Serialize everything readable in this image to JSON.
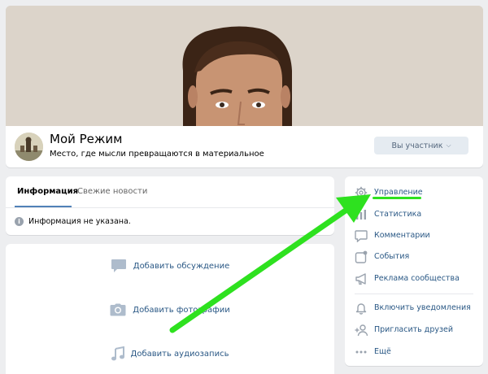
{
  "community": {
    "name": "Мой Режим",
    "status": "Место, где мысли превращаются в материальное",
    "member_button": "Вы участник",
    "member_chevron": "⌵"
  },
  "info_tabs": {
    "tabs": [
      {
        "label": "Информация",
        "active": true
      },
      {
        "label": "Свежие новости",
        "active": false
      }
    ],
    "info_icon": "i",
    "info_text": "Информация не указана."
  },
  "actions": [
    {
      "label": "Добавить обсуждение",
      "icon": "discussion-icon"
    },
    {
      "label": "Добавить фотографии",
      "icon": "camera-icon"
    },
    {
      "label": "Добавить аудиозапись",
      "icon": "music-note-icon"
    }
  ],
  "side_menu": {
    "items": [
      {
        "label": "Управление",
        "icon": "gear-icon"
      },
      {
        "label": "Статистика",
        "icon": "statistics-icon"
      },
      {
        "label": "Комментарии",
        "icon": "comment-icon"
      },
      {
        "label": "События",
        "icon": "events-icon"
      },
      {
        "label": "Реклама сообщества",
        "icon": "megaphone-icon"
      },
      {
        "label": "Включить уведомления",
        "icon": "bell-icon"
      },
      {
        "label": "Пригласить друзей",
        "icon": "invite-friends-icon"
      },
      {
        "label": "Ещё",
        "icon": "more-icon"
      }
    ]
  },
  "colors": {
    "background": "#edeef0",
    "link": "#2a5885",
    "accent": "#5181b8",
    "annotation_arrow": "#2ee11f"
  }
}
